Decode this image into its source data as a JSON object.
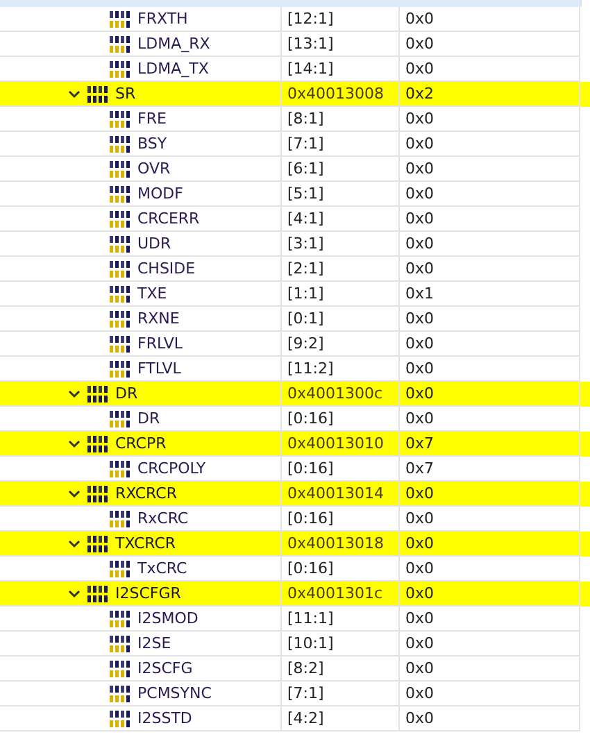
{
  "tree": [
    {
      "kind": "field",
      "name": "FRXTH",
      "bits": "[12:1]",
      "value": "0x0"
    },
    {
      "kind": "field",
      "name": "LDMA_RX",
      "bits": "[13:1]",
      "value": "0x0"
    },
    {
      "kind": "field",
      "name": "LDMA_TX",
      "bits": "[14:1]",
      "value": "0x0"
    },
    {
      "kind": "register",
      "name": "SR",
      "address": "0x40013008",
      "value": "0x2",
      "expanded": true,
      "children": [
        {
          "kind": "field",
          "name": "FRE",
          "bits": "[8:1]",
          "value": "0x0"
        },
        {
          "kind": "field",
          "name": "BSY",
          "bits": "[7:1]",
          "value": "0x0"
        },
        {
          "kind": "field",
          "name": "OVR",
          "bits": "[6:1]",
          "value": "0x0"
        },
        {
          "kind": "field",
          "name": "MODF",
          "bits": "[5:1]",
          "value": "0x0"
        },
        {
          "kind": "field",
          "name": "CRCERR",
          "bits": "[4:1]",
          "value": "0x0"
        },
        {
          "kind": "field",
          "name": "UDR",
          "bits": "[3:1]",
          "value": "0x0"
        },
        {
          "kind": "field",
          "name": "CHSIDE",
          "bits": "[2:1]",
          "value": "0x0"
        },
        {
          "kind": "field",
          "name": "TXE",
          "bits": "[1:1]",
          "value": "0x1"
        },
        {
          "kind": "field",
          "name": "RXNE",
          "bits": "[0:1]",
          "value": "0x0"
        },
        {
          "kind": "field",
          "name": "FRLVL",
          "bits": "[9:2]",
          "value": "0x0"
        },
        {
          "kind": "field",
          "name": "FTLVL",
          "bits": "[11:2]",
          "value": "0x0"
        }
      ]
    },
    {
      "kind": "register",
      "name": "DR",
      "address": "0x4001300c",
      "value": "0x0",
      "expanded": true,
      "children": [
        {
          "kind": "field",
          "name": "DR",
          "bits": "[0:16]",
          "value": "0x0"
        }
      ]
    },
    {
      "kind": "register",
      "name": "CRCPR",
      "address": "0x40013010",
      "value": "0x7",
      "expanded": true,
      "children": [
        {
          "kind": "field",
          "name": "CRCPOLY",
          "bits": "[0:16]",
          "value": "0x7"
        }
      ]
    },
    {
      "kind": "register",
      "name": "RXCRCR",
      "address": "0x40013014",
      "value": "0x0",
      "expanded": true,
      "children": [
        {
          "kind": "field",
          "name": "RxCRC",
          "bits": "[0:16]",
          "value": "0x0"
        }
      ]
    },
    {
      "kind": "register",
      "name": "TXCRCR",
      "address": "0x40013018",
      "value": "0x0",
      "expanded": true,
      "children": [
        {
          "kind": "field",
          "name": "TxCRC",
          "bits": "[0:16]",
          "value": "0x0"
        }
      ]
    },
    {
      "kind": "register",
      "name": "I2SCFGR",
      "address": "0x4001301c",
      "value": "0x0",
      "expanded": true,
      "children": [
        {
          "kind": "field",
          "name": "I2SMOD",
          "bits": "[11:1]",
          "value": "0x0"
        },
        {
          "kind": "field",
          "name": "I2SE",
          "bits": "[10:1]",
          "value": "0x0"
        },
        {
          "kind": "field",
          "name": "I2SCFG",
          "bits": "[8:2]",
          "value": "0x0"
        },
        {
          "kind": "field",
          "name": "PCMSYNC",
          "bits": "[7:1]",
          "value": "0x0"
        },
        {
          "kind": "field",
          "name": "I2SSTD",
          "bits": "[4:2]",
          "value": "0x0"
        }
      ]
    }
  ]
}
